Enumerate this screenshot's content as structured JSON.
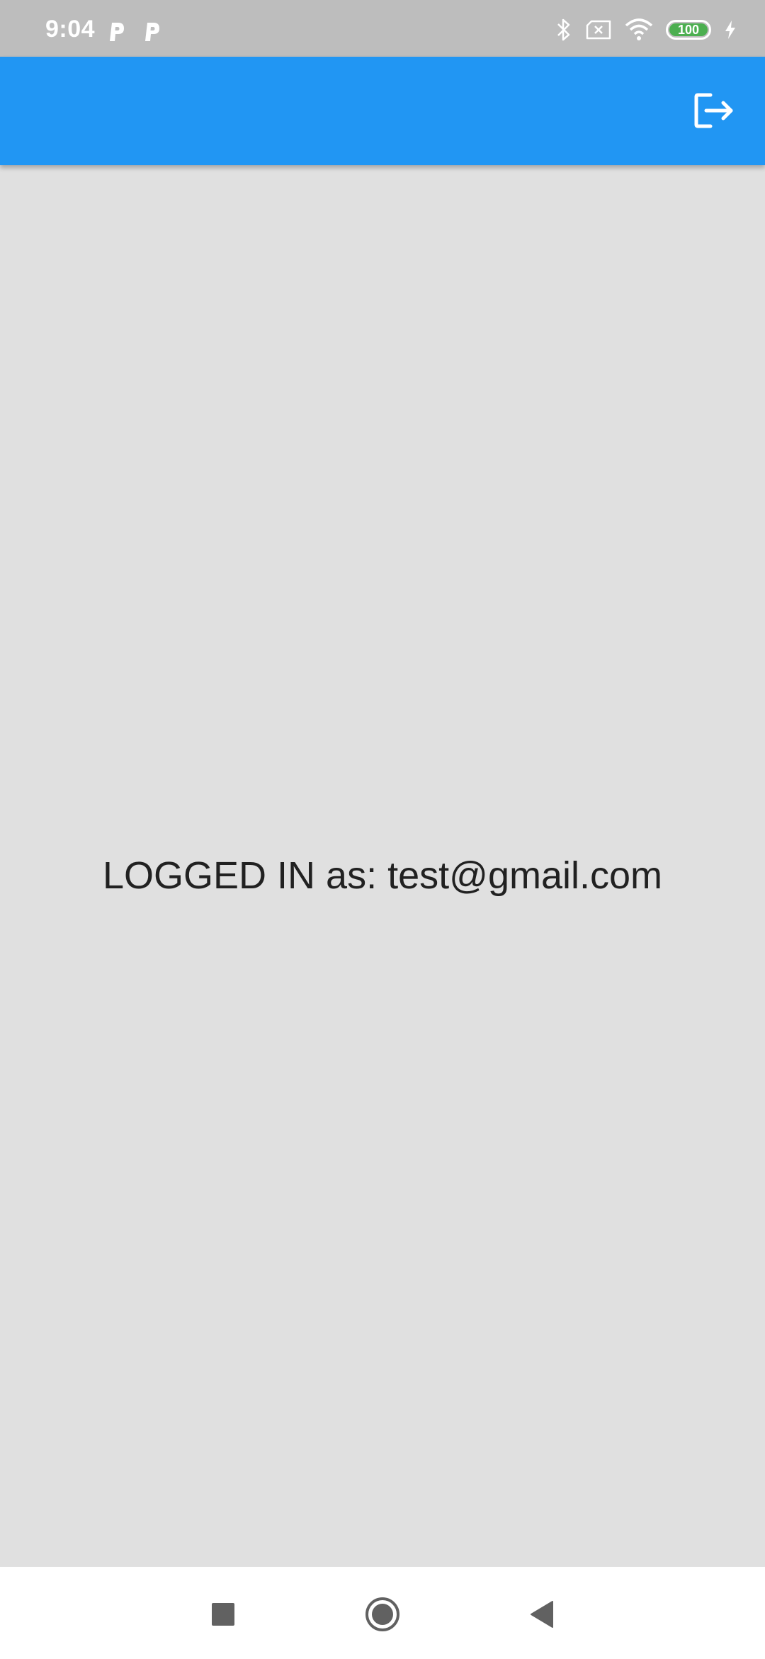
{
  "status_bar": {
    "time": "9:04",
    "battery_level": 100,
    "battery_text": "100",
    "charging": true,
    "left_icons": [
      "parking-icon",
      "parking-icon"
    ],
    "right_icons": [
      "bluetooth-icon",
      "sim-absent-icon",
      "wifi-icon",
      "battery-icon",
      "charging-icon"
    ]
  },
  "app_bar": {
    "color": "#2196f3",
    "actions": [
      "logout-icon"
    ]
  },
  "main": {
    "login_status": "LOGGED IN as: test@gmail.com"
  },
  "nav_bar": {
    "buttons": [
      "recents-icon",
      "home-icon",
      "back-icon"
    ]
  },
  "colors": {
    "status_bar": "#bdbdbd",
    "background": "#e0e0e0",
    "battery_fill": "#4caf50"
  }
}
